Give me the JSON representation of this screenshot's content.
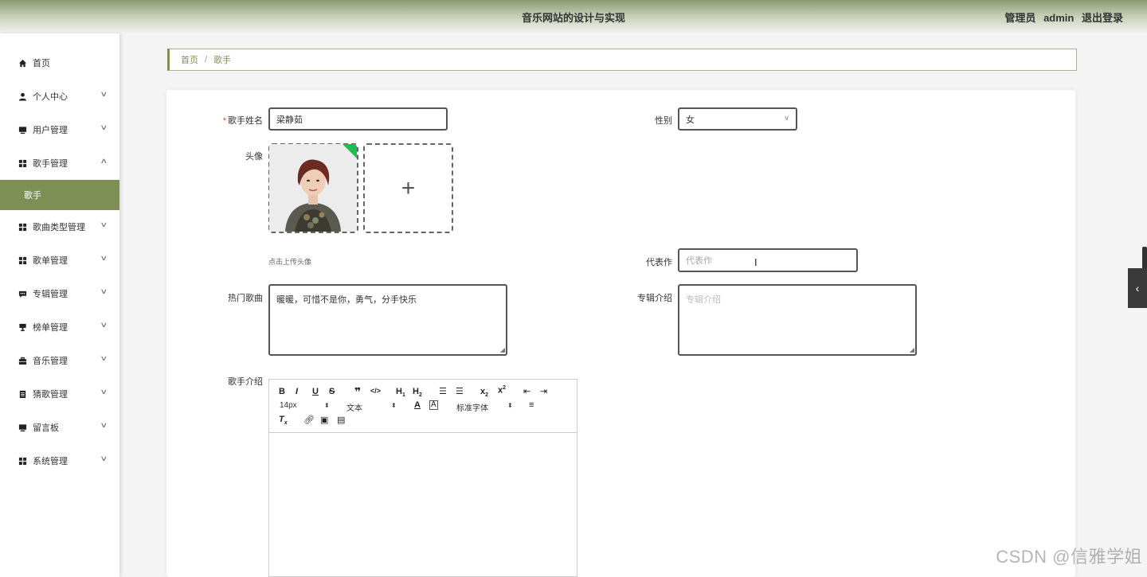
{
  "header": {
    "title": "音乐网站的设计与实现",
    "role": "管理员",
    "username": "admin",
    "logout": "退出登录"
  },
  "sidebar": {
    "items": [
      {
        "label": "首页",
        "icon": "home-icon"
      },
      {
        "label": "个人中心",
        "icon": "user-icon"
      },
      {
        "label": "用户管理",
        "icon": "monitor-icon"
      },
      {
        "label": "歌手管理",
        "icon": "grid-icon"
      },
      {
        "label": "歌曲类型管理",
        "icon": "grid-icon"
      },
      {
        "label": "歌单管理",
        "icon": "grid-icon"
      },
      {
        "label": "专辑管理",
        "icon": "comment-icon"
      },
      {
        "label": "榜单管理",
        "icon": "trophy-icon"
      },
      {
        "label": "音乐管理",
        "icon": "briefcase-icon"
      },
      {
        "label": "猜歌管理",
        "icon": "document-icon"
      },
      {
        "label": "留言板",
        "icon": "monitor-icon"
      },
      {
        "label": "系统管理",
        "icon": "grid-icon"
      }
    ],
    "active_sub": "歌手"
  },
  "breadcrumb": {
    "home": "首页",
    "sep": "/",
    "current": "歌手"
  },
  "form": {
    "name_label": "歌手姓名",
    "name_value": "梁静茹",
    "gender_label": "性别",
    "gender_value": "女",
    "avatar_label": "头像",
    "avatar_hint": "点击上传头像",
    "works_label": "代表作",
    "works_placeholder": "代表作",
    "hot_label": "热门歌曲",
    "hot_value": "暖暖，可惜不是你，勇气，分手快乐",
    "album_label": "专辑介绍",
    "album_placeholder": "专辑介绍",
    "intro_label": "歌手介绍"
  },
  "editor": {
    "font_size": "14px",
    "text_type": "文本",
    "font_family": "标准字体"
  },
  "watermark": "CSDN @信雅学姐"
}
